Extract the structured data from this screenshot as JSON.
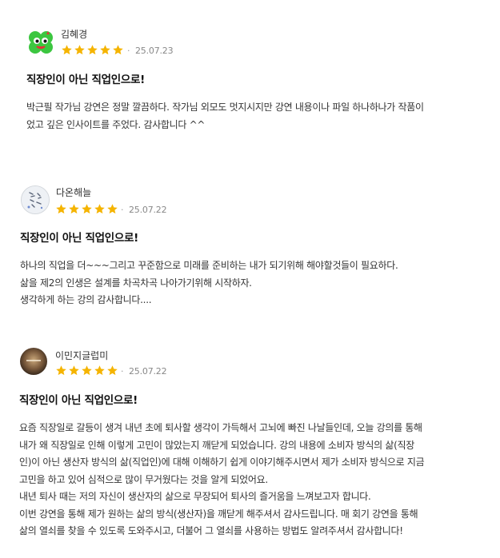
{
  "reviews": [
    {
      "author": "김혜경",
      "rating": 5,
      "date": "25.07.23",
      "title": "직장인이 아닌 직업인으로!",
      "lines": [
        "박근필 작가님 강연은 정말 깔끔하다. 작가님 외모도 멋지시지만 강연 내용이나 파일 하나하나가 작품이",
        "었고 깊은 인사이트를 주었다. 감사합니다 ^^"
      ]
    },
    {
      "author": "다온해늘",
      "rating": 5,
      "date": "25.07.22",
      "title": "직장인이 아닌 직업인으로!",
      "lines": [
        "하나의 직업을 더~~~그리고 꾸준함으로 미래를 준비하는 내가 되기위해 해야할것들이 필요하다.",
        "삶을 제2의 인생은 설계를 차곡차곡 나아가기위해 시작하자.",
        "생각하게 하는 강의 감사합니다...."
      ]
    },
    {
      "author": "이민지글럽미",
      "rating": 5,
      "date": "25.07.22",
      "title": "직장인이 아닌 직업인으로!",
      "lines": [
        "요즘 직장일로 갈등이 생겨 내년 초에 퇴사할 생각이 가득해서 고뇌에 빠진 나날들인데, 오늘 강의를 통해",
        "내가 왜 직장일로 인해 이렇게 고민이 많았는지 깨닫게 되었습니다. 강의 내용에 소비자 방식의 삶(직장",
        "인)이 아닌 생산자 방식의 삶(직업인)에 대해 이해하기 쉽게 이야기해주시면서 제가 소비자 방식으로 지금",
        "고민을 하고 있어 심적으로 많이 무거웠다는 것을 알게 되었어요.",
        "내년 퇴사 때는 저의 자신이 생산자의 삶으로 무장되어 퇴사의 즐거움을 느껴보고자 합니다.",
        "이번 강연을 통해 제가 원하는 삶의 방식(생산자)을 깨닫게 해주셔서 감사드립니다. 매 회기 강연을 통해",
        "삶의 열쇠를 찾을 수 있도록 도와주시고, 더불어 그 열쇠를 사용하는 방법도 알려주셔서 감사합니다!"
      ]
    }
  ],
  "icons": {
    "star": "star-icon",
    "star_color": "#f5b400"
  }
}
